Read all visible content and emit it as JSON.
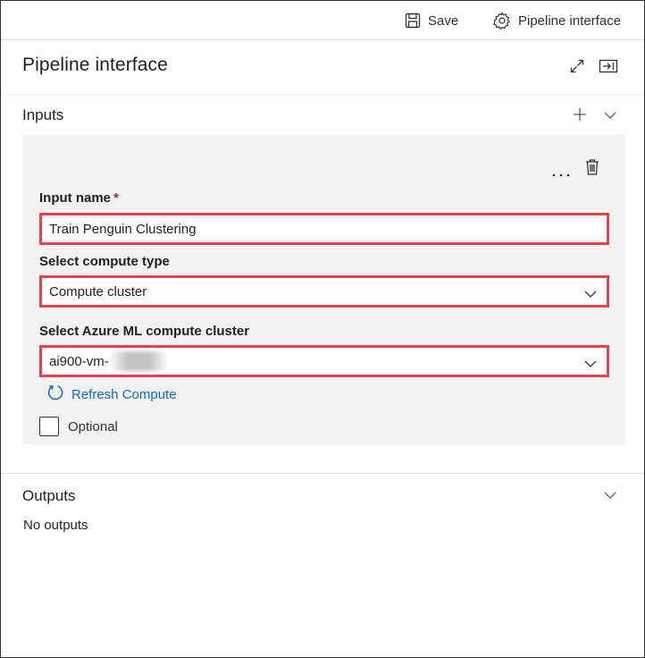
{
  "toolbar": {
    "save_label": "Save",
    "pipeline_interface_label": "Pipeline interface"
  },
  "panel": {
    "title": "Pipeline interface"
  },
  "inputs": {
    "section_title": "Inputs",
    "input_name_label": "Input name",
    "required_marker": "*",
    "input_name_value": "Train Penguin Clustering",
    "compute_type_label": "Select compute type",
    "compute_type_value": "Compute cluster",
    "compute_cluster_label": "Select Azure ML compute cluster",
    "compute_cluster_value": "ai900-vm-",
    "refresh_label": "Refresh Compute",
    "optional_label": "Optional",
    "optional_checked": false
  },
  "outputs": {
    "section_title": "Outputs",
    "empty_text": "No outputs"
  },
  "colors": {
    "highlight_border": "#e0444c",
    "link": "#0f6cbd",
    "card_background": "#f3f2f1",
    "required": "#a4262c"
  },
  "icons": [
    "save-icon",
    "gear-icon",
    "expand-icon",
    "dock-panel-icon",
    "add-icon",
    "chevron-down-icon",
    "more-icon",
    "delete-icon",
    "refresh-icon"
  ]
}
